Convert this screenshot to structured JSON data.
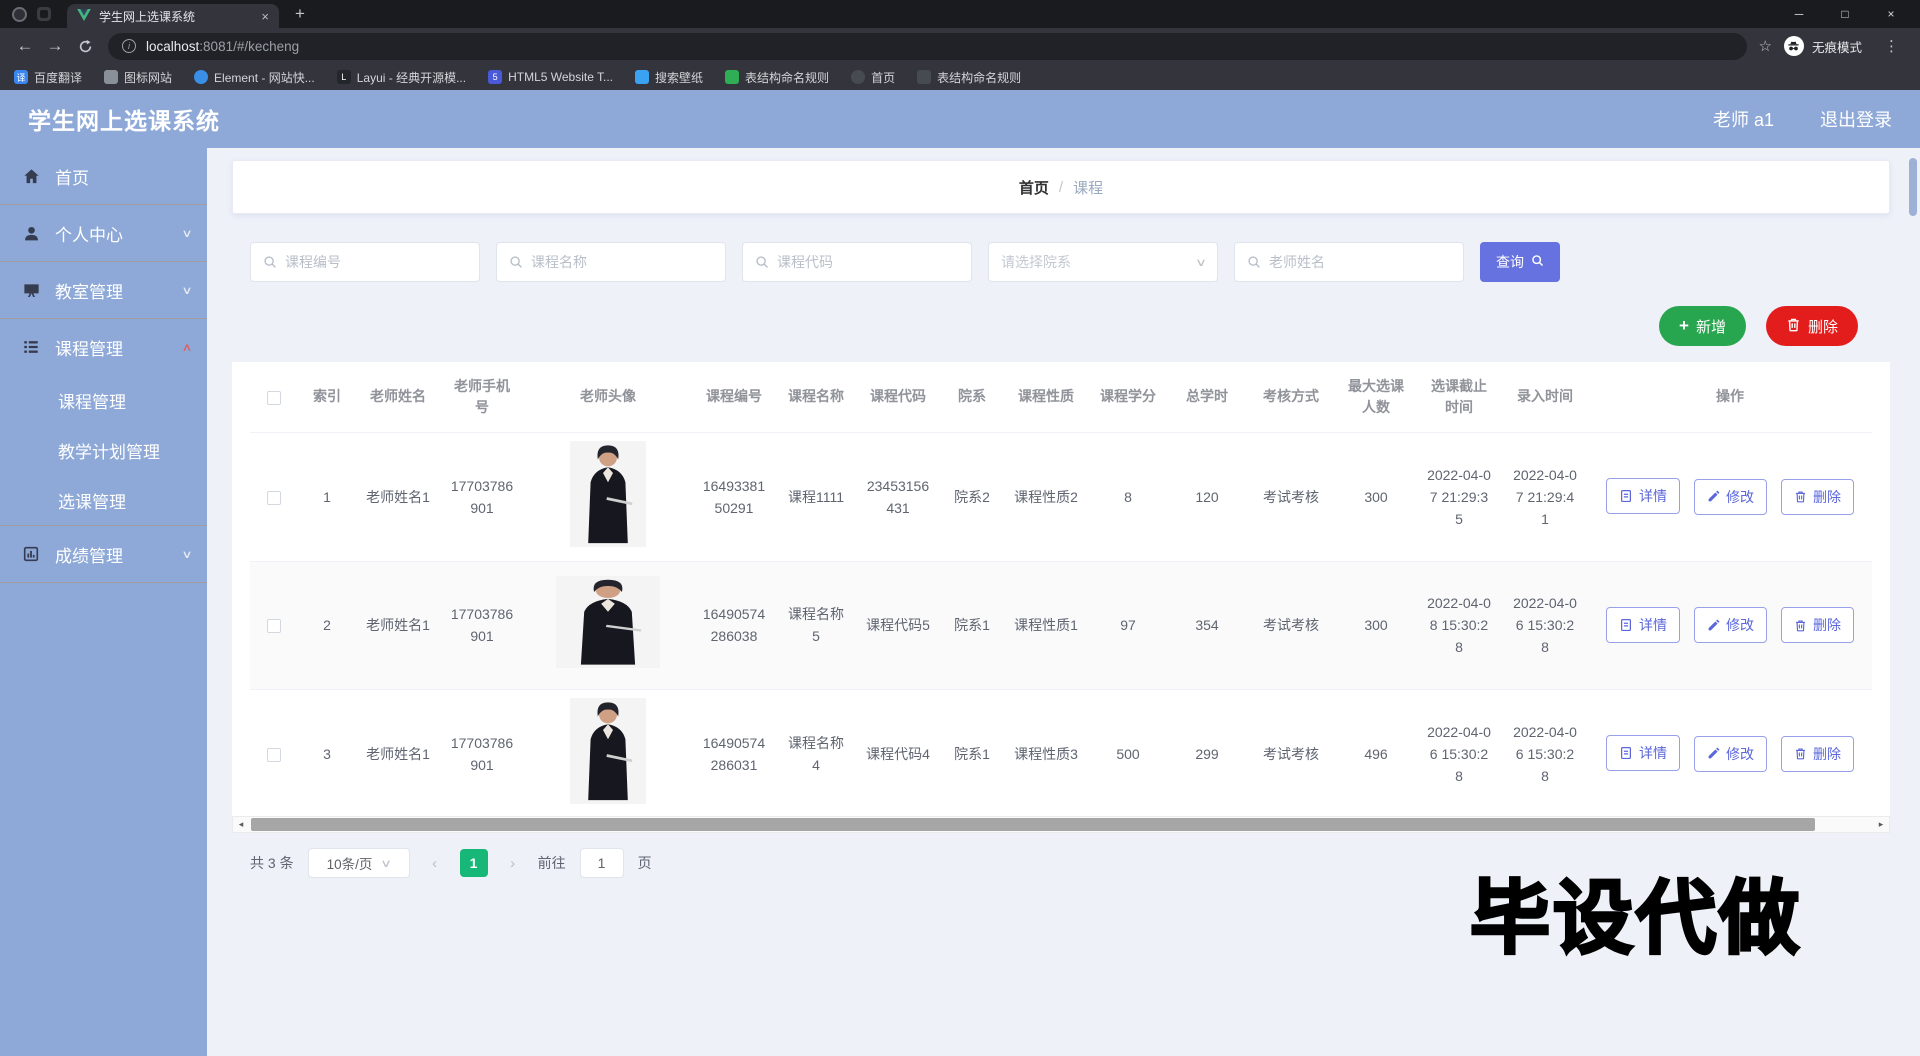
{
  "colors": {
    "theme_blue": "#8ea9d7",
    "accent_indigo": "#6672e0",
    "add_green": "#28a54f",
    "delete_red": "#e31c1c",
    "pager_green": "#17b877"
  },
  "browser": {
    "tab_title": "学生网上选课系统",
    "url_host": "localhost",
    "url_path": ":8081/#/kecheng",
    "incognito_label": "无痕模式",
    "window_controls": {
      "minimize": "─",
      "maximize": "□",
      "close": "×"
    },
    "bookmarks": [
      {
        "label": "百度翻译",
        "icon": "baidu-translate-icon",
        "color": "#3a86f0",
        "glyph": "译",
        "shape": "square"
      },
      {
        "label": "图标网站",
        "icon": "folder-icon",
        "color": "#8a9097",
        "glyph": "",
        "shape": "square"
      },
      {
        "label": "Element - 网站快...",
        "icon": "element-site-icon",
        "color": "#3a8ee6",
        "glyph": "",
        "shape": "circle"
      },
      {
        "label": "Layui - 经典开源模...",
        "icon": "layui-site-icon",
        "color": "#23262b",
        "glyph": "L",
        "shape": "square"
      },
      {
        "label": "HTML5 Website T...",
        "icon": "html5-site-icon",
        "color": "#4a59d8",
        "glyph": "5",
        "shape": "square"
      },
      {
        "label": "搜索壁纸",
        "icon": "wallpaper-site-icon",
        "color": "#3aa2f0",
        "glyph": "",
        "shape": "square"
      },
      {
        "label": "表结构命名规则",
        "icon": "rules-site-icon",
        "color": "#2fae55",
        "glyph": "",
        "shape": "square"
      },
      {
        "label": "首页",
        "icon": "home-site-icon",
        "color": "#464b52",
        "glyph": "",
        "shape": "circle"
      },
      {
        "label": "表结构命名规则",
        "icon": "rules-site-icon-2",
        "color": "#464b52",
        "glyph": "",
        "shape": "square"
      }
    ]
  },
  "header": {
    "title": "学生网上选课系统",
    "user": "老师 a1",
    "logout": "退出登录"
  },
  "sidebar": {
    "items": [
      {
        "key": "home",
        "label": "首页",
        "icon": "home-icon",
        "arrow": ""
      },
      {
        "key": "profile",
        "label": "个人中心",
        "icon": "user-icon",
        "arrow": "down"
      },
      {
        "key": "classroom-mgmt",
        "label": "教室管理",
        "icon": "classroom-icon",
        "arrow": "down"
      },
      {
        "key": "course-mgmt",
        "label": "课程管理",
        "icon": "course-icon",
        "arrow": "up",
        "children": [
          {
            "key": "course-mgmt-sub",
            "label": "课程管理"
          },
          {
            "key": "teaching-plan-mgmt",
            "label": "教学计划管理"
          },
          {
            "key": "course-selection-mgmt",
            "label": "选课管理"
          }
        ]
      },
      {
        "key": "grade-mgmt",
        "label": "成绩管理",
        "icon": "grades-icon",
        "arrow": "down"
      }
    ]
  },
  "breadcrumb": {
    "current_section": "首页",
    "separator": "/",
    "current_page": "课程"
  },
  "filters": {
    "fields": [
      {
        "key": "course-no",
        "placeholder": "课程编号",
        "type": "text"
      },
      {
        "key": "course-name",
        "placeholder": "课程名称",
        "type": "text"
      },
      {
        "key": "course-code",
        "placeholder": "课程代码",
        "type": "text"
      },
      {
        "key": "department",
        "placeholder": "请选择院系",
        "type": "select"
      },
      {
        "key": "teacher-name",
        "placeholder": "老师姓名",
        "type": "text"
      }
    ],
    "search_label": "查询"
  },
  "toolbar": {
    "add_label": "新增",
    "delete_label": "删除"
  },
  "table": {
    "columns": [
      {
        "key": "sel",
        "label": ""
      },
      {
        "key": "index",
        "label": "索引"
      },
      {
        "key": "teacher_name",
        "label": "老师姓名"
      },
      {
        "key": "teacher_phone",
        "label": "老师手机号"
      },
      {
        "key": "teacher_avatar",
        "label": "老师头像"
      },
      {
        "key": "course_no",
        "label": "课程编号"
      },
      {
        "key": "course_name",
        "label": "课程名称"
      },
      {
        "key": "course_code",
        "label": "课程代码"
      },
      {
        "key": "department",
        "label": "院系"
      },
      {
        "key": "course_nature",
        "label": "课程性质"
      },
      {
        "key": "course_credit",
        "label": "课程学分"
      },
      {
        "key": "total_hours",
        "label": "总学时"
      },
      {
        "key": "assessment",
        "label": "考核方式"
      },
      {
        "key": "max_students",
        "label": "最大选课人数"
      },
      {
        "key": "deadline",
        "label": "选课截止时间"
      },
      {
        "key": "entry_time",
        "label": "录入时间"
      },
      {
        "key": "ops",
        "label": "操作"
      }
    ],
    "rows": [
      {
        "index": "1",
        "teacher_name": "老师姓名1",
        "teacher_phone": "17703786901",
        "avatar": "portrait",
        "course_no": "1649338150291",
        "course_name": "课程1111",
        "course_code": "23453156431",
        "department": "院系2",
        "course_nature": "课程性质2",
        "course_credit": "8",
        "total_hours": "120",
        "assessment": "考试考核",
        "max_students": "300",
        "deadline": "2022-04-07 21:29:35",
        "entry_time": "2022-04-07 21:29:41"
      },
      {
        "index": "2",
        "teacher_name": "老师姓名1",
        "teacher_phone": "17703786901",
        "avatar": "wide",
        "course_no": "16490574286038",
        "course_name": "课程名称5",
        "course_code": "课程代码5",
        "department": "院系1",
        "course_nature": "课程性质1",
        "course_credit": "97",
        "total_hours": "354",
        "assessment": "考试考核",
        "max_students": "300",
        "deadline": "2022-04-08 15:30:28",
        "entry_time": "2022-04-06 15:30:28"
      },
      {
        "index": "3",
        "teacher_name": "老师姓名1",
        "teacher_phone": "17703786901",
        "avatar": "portrait",
        "course_no": "16490574286031",
        "course_name": "课程名称4",
        "course_code": "课程代码4",
        "department": "院系1",
        "course_nature": "课程性质3",
        "course_credit": "500",
        "total_hours": "299",
        "assessment": "考试考核",
        "max_students": "496",
        "deadline": "2022-04-06 15:30:28",
        "entry_time": "2022-04-06 15:30:28"
      }
    ],
    "row_actions": [
      {
        "key": "detail",
        "label": "详情",
        "icon": "document-icon"
      },
      {
        "key": "edit",
        "label": "修改",
        "icon": "edit-icon"
      },
      {
        "key": "delete",
        "label": "删除",
        "icon": "trash-icon"
      }
    ]
  },
  "pagination": {
    "total": "共 3 条",
    "page_size": "10条/页",
    "current_page": "1",
    "goto_label": "前往",
    "goto_value": "1",
    "unit_label": "页"
  },
  "watermark": "毕设代做"
}
